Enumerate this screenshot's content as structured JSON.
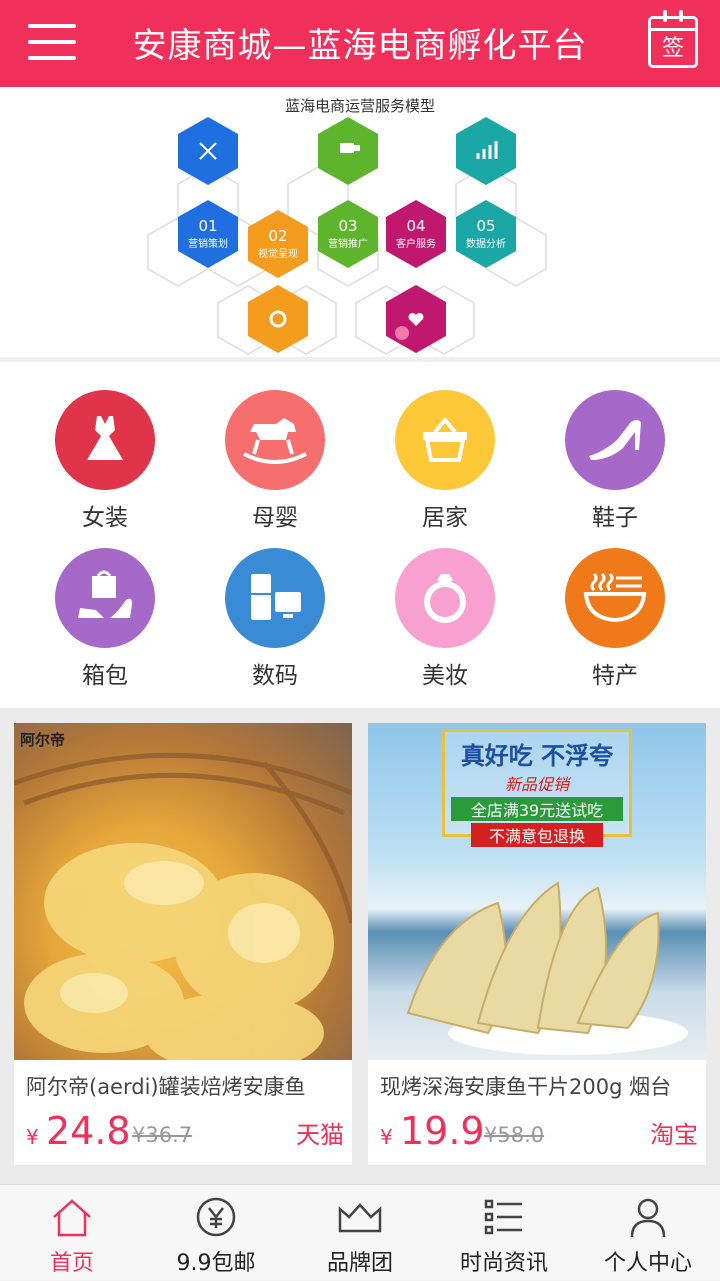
{
  "header": {
    "title": "安康商城—蓝海电商孵化平台",
    "sign_label": "签"
  },
  "banner": {
    "title": "蓝海电商运营服务模型",
    "steps": [
      {
        "num": "01",
        "label": "营销策划",
        "color": "#1f6fe0"
      },
      {
        "num": "02",
        "label": "视觉呈现",
        "color": "#f39c1d"
      },
      {
        "num": "03",
        "label": "营销推广",
        "color": "#5fb42e"
      },
      {
        "num": "04",
        "label": "客户服务",
        "color": "#c0186e"
      },
      {
        "num": "05",
        "label": "数据分析",
        "color": "#1ba7a6"
      }
    ]
  },
  "categories": [
    {
      "label": "女装",
      "color": "#e0344a",
      "icon": "dress-icon"
    },
    {
      "label": "母婴",
      "color": "#f76e6e",
      "icon": "rocking-horse-icon"
    },
    {
      "label": "居家",
      "color": "#fcc838",
      "icon": "basket-icon"
    },
    {
      "label": "鞋子",
      "color": "#a669c9",
      "icon": "high-heel-icon"
    },
    {
      "label": "箱包",
      "color": "#a669c9",
      "icon": "bag-icon"
    },
    {
      "label": "数码",
      "color": "#3a8bd6",
      "icon": "digital-icon"
    },
    {
      "label": "美妆",
      "color": "#f8a0d0",
      "icon": "ring-icon"
    },
    {
      "label": "特产",
      "color": "#f07a1a",
      "icon": "noodle-bowl-icon"
    }
  ],
  "products": [
    {
      "name": "阿尔帝(aerdi)罐装焙烤安康鱼",
      "yen": "¥",
      "price": "24.8",
      "old_price": "¥36.7",
      "shop": "天猫",
      "brand": "阿尔帝"
    },
    {
      "name": "现烤深海安康鱼干片200g 烟台",
      "yen": "¥",
      "price": "19.9",
      "old_price": "¥58.0",
      "shop": "淘宝",
      "promo": [
        "真好吃 不浮夸",
        "新品促销",
        "全店满39元送试吃",
        "不满意包退换"
      ]
    }
  ],
  "tabs": [
    {
      "label": "首页",
      "icon": "home-icon"
    },
    {
      "label": "9.9包邮",
      "icon": "yen-coin-icon"
    },
    {
      "label": "品牌团",
      "icon": "crown-icon"
    },
    {
      "label": "时尚资讯",
      "icon": "list-icon"
    },
    {
      "label": "个人中心",
      "icon": "user-icon"
    }
  ],
  "colors": {
    "brand": "#f0305a"
  }
}
